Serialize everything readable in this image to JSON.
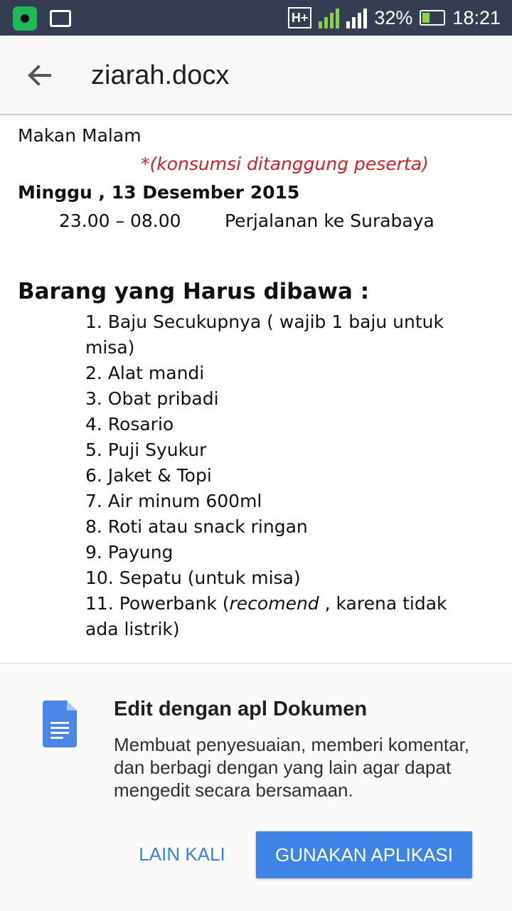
{
  "status_bar": {
    "network": "H+",
    "sim1": "1",
    "sim2": "2",
    "battery": "32%",
    "time": "18:21"
  },
  "app_bar": {
    "back_icon": "arrow-back-icon",
    "title": "ziarah.docx"
  },
  "document": {
    "line1": "Makan Malam",
    "note": "*(konsumsi ditanggung peserta)",
    "date": "Minggu , 13 Desember 2015",
    "time_range": "23.00 – 08.00",
    "activity": "Perjalanan ke Surabaya",
    "heading": "Barang yang Harus dibawa :",
    "items": [
      "1. Baju Secukupnya ( wajib 1 baju untuk",
      "misa)",
      "2. Alat mandi",
      "3. Obat pribadi",
      "4. Rosario",
      "5. Puji Syukur",
      "6. Jaket & Topi",
      "7. Air minum 600ml",
      "8. Roti atau snack ringan",
      "9. Payung",
      "10. Sepatu (untuk misa)"
    ],
    "item11_prefix": "11. Powerbank (",
    "item11_italic": "recomend",
    "item11_suffix": " , karena tidak",
    "item11_line2": "ada listrik)"
  },
  "prompt_sheet": {
    "icon": "google-docs-icon",
    "title": "Edit dengan apl Dokumen",
    "body": "Membuat penyesuaian, memberi komentar, dan berbagi dengan yang lain agar dapat mengedit secara bersamaan.",
    "later_label": "LAIN KALI",
    "use_label": "GUNAKAN APLIKASI",
    "accent_color": "#3d84e6"
  }
}
